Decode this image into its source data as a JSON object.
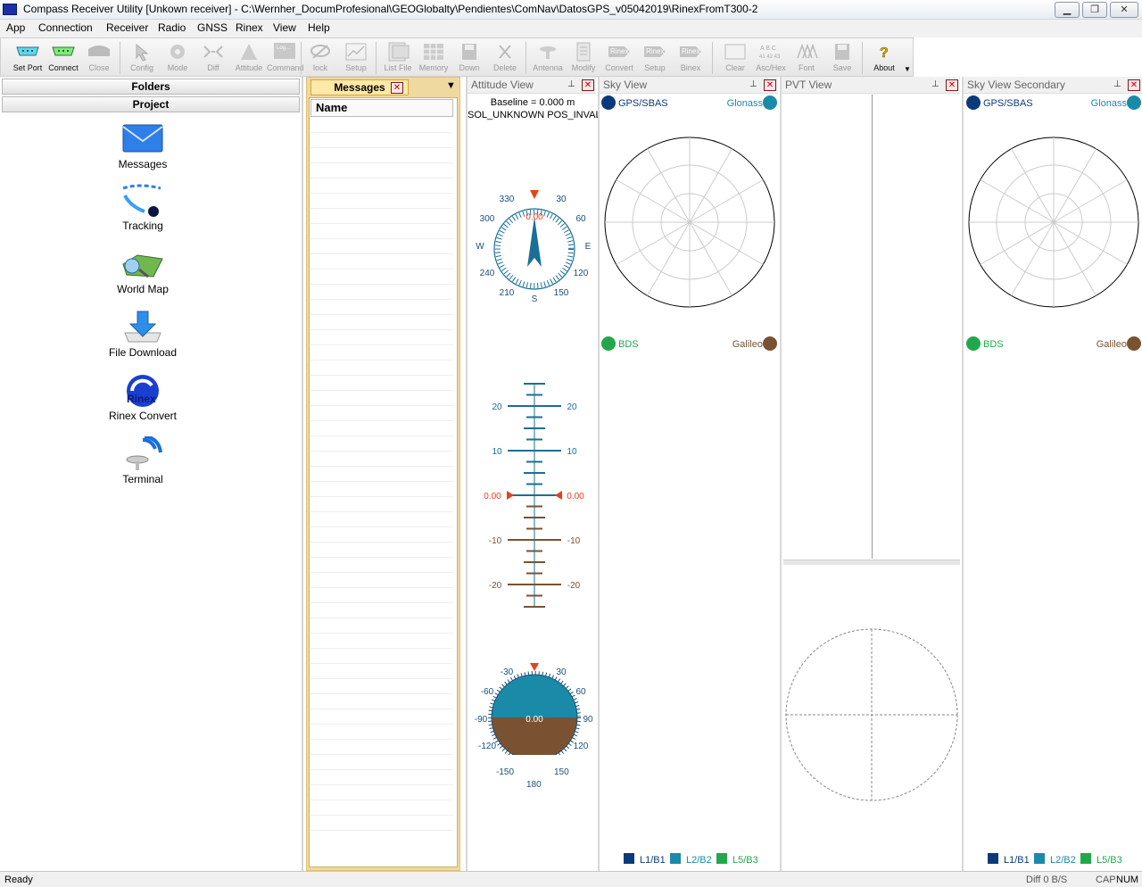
{
  "window": {
    "title": "Compass Receiver Utility [Unkown receiver] - C:\\Wernher_DocumProfesional\\GEOGlobalty\\Pendientes\\ComNav\\DatosGPS_v05042019\\RinexFromT300-2"
  },
  "menu": [
    "App",
    "Connection",
    "Receiver",
    "Radio",
    "GNSS",
    "Rinex",
    "View",
    "Help"
  ],
  "toolbar": {
    "set_port": "Set Port",
    "connect": "Connect",
    "close": "Close",
    "config": "Config",
    "mode": "Mode",
    "diff": "Diff",
    "attitude": "Attitude",
    "command": "Command",
    "lock": "lock",
    "setup": "Setup",
    "list_file": "List File",
    "memory": "Memory",
    "down": "Down",
    "delete": "Delete",
    "antenna": "Antenna",
    "modify": "Modify",
    "convert": "Convert",
    "rinex_setup": "Setup",
    "binex": "Binex",
    "clear": "Clear",
    "ascihex": "Asc/Hex",
    "font": "Font",
    "save": "Save",
    "about": "About",
    "log_glyph": "Log...",
    "rinex_glyph": "Rinex",
    "abc_glyph": "A B C",
    "hex_glyph": "41 42 43",
    "binex_glyph": "Rinex"
  },
  "left": {
    "folders": "Folders",
    "project": "Project",
    "items": [
      "Messages",
      "Tracking",
      "World Map",
      "File Download",
      "Rinex Convert",
      "Terminal"
    ],
    "rinex_logo_text": "Rinex"
  },
  "messages": {
    "tab": "Messages",
    "column": "Name"
  },
  "attitude": {
    "title": "Attitude View",
    "baseline": "Baseline = 0.000 m",
    "status": "SOL_UNKNOWN POS_INVALID",
    "compass": {
      "n": "330",
      "ne": "30",
      "w300": "300",
      "e60": "60",
      "w": "W",
      "e": "E",
      "sw": "240",
      "se": "120",
      "s210": "210",
      "s150": "150",
      "s": "S",
      "heading": "0.00"
    },
    "pitch": {
      "p20": "20",
      "p10": "10",
      "zero": "0.00",
      "m10": "-10",
      "m20": "-20"
    },
    "roll": {
      "m30": "-30",
      "p30": "30",
      "m60": "-60",
      "p60": "60",
      "m90": "-90",
      "p90": "90",
      "m120": "-120",
      "p120": "120",
      "m150": "-150",
      "p150": "150",
      "p180": "180",
      "value": "0.00"
    }
  },
  "sky": {
    "title": "Sky View",
    "gps": "GPS/SBAS",
    "glonass": "Glonass",
    "bds": "BDS",
    "galileo": "Galileo",
    "legend": [
      "L1/B1",
      "L2/B2",
      "L5/B3"
    ]
  },
  "pvt": {
    "title": "PVT View"
  },
  "sky2": {
    "title": "Sky View Secondary",
    "gps": "GPS/SBAS",
    "glonass": "Glonass",
    "bds": "BDS",
    "galileo": "Galileo",
    "legend": [
      "L1/B1",
      "L2/B2",
      "L5/B3"
    ]
  },
  "status": {
    "ready": "Ready",
    "diff": "Diff 0 B/S",
    "cap": "CAP",
    "num": "NUM"
  },
  "colors": {
    "gps": "#0b3a7a",
    "glonass": "#1a8aa8",
    "bds": "#22a84a",
    "galileo": "#7a5232",
    "accent": "#1a6f96",
    "marker": "#e8401a"
  }
}
